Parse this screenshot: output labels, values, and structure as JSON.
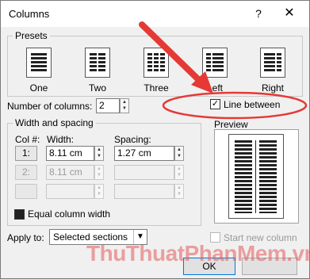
{
  "window": {
    "title": "Columns",
    "help_label": "?",
    "close_label": "✕"
  },
  "presets": {
    "group_label": "Presets",
    "items": [
      {
        "label": "One",
        "key": "O"
      },
      {
        "label": "Two",
        "key": "w"
      },
      {
        "label": "Three",
        "key": "T"
      },
      {
        "label": "Left",
        "key": "L"
      },
      {
        "label": "Right",
        "key": "R"
      }
    ]
  },
  "number_of_columns": {
    "label": "Number of columns:",
    "value": "2"
  },
  "line_between": {
    "label": "Line between",
    "checked": true
  },
  "width_spacing": {
    "group_label": "Width and spacing",
    "headers": {
      "col": "Col #:",
      "width": "Width:",
      "spacing": "Spacing:"
    },
    "rows": [
      {
        "col": "1:",
        "width": "8.11 cm",
        "spacing": "1.27 cm",
        "enabled": true
      },
      {
        "col": "2:",
        "width": "8.11 cm",
        "spacing": "",
        "enabled": false
      },
      {
        "col": "",
        "width": "",
        "spacing": "",
        "enabled": false
      }
    ],
    "equal_width": {
      "label": "Equal column width",
      "checked": true
    }
  },
  "preview": {
    "label": "Preview"
  },
  "apply_to": {
    "label": "Apply to:",
    "value": "Selected sections"
  },
  "start_new_column": {
    "label": "Start new column",
    "checked": false
  },
  "buttons": {
    "ok": "OK"
  },
  "watermark": {
    "text": "ThuThuatPhanMem.vn"
  },
  "colors": {
    "arrow": "#e53935",
    "highlight": "#e53935",
    "accent": "#0078d7"
  }
}
